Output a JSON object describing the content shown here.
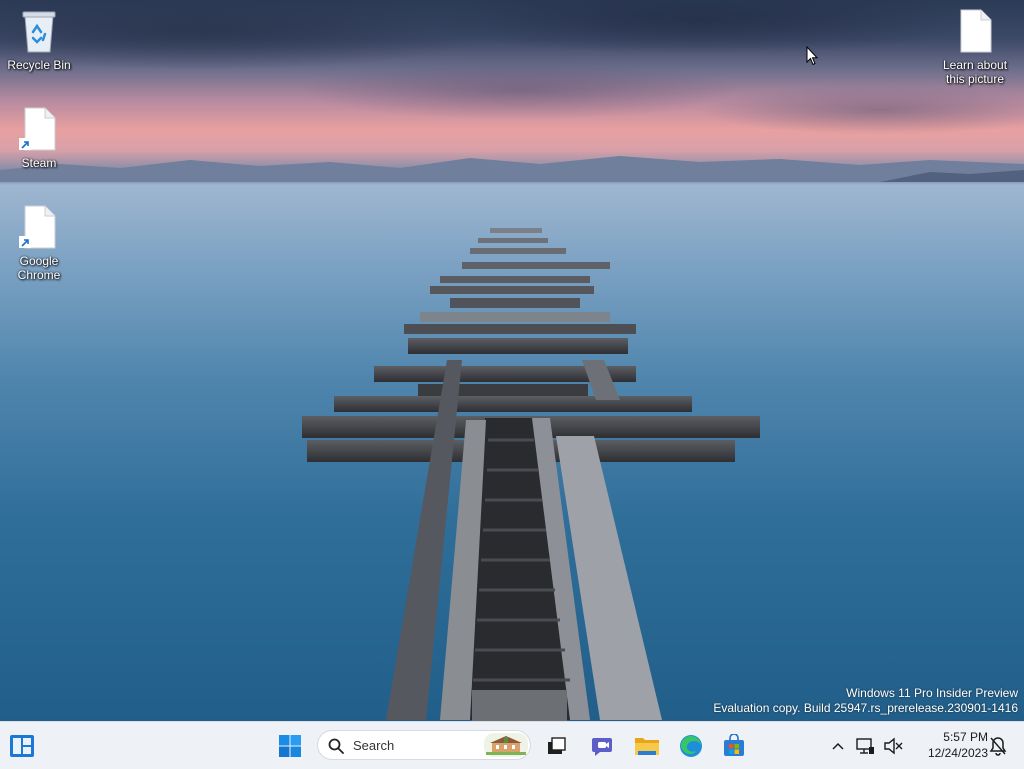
{
  "desktop": {
    "icons": [
      {
        "label": "Recycle Bin",
        "icon": "recycle-bin-icon"
      },
      {
        "label": "Steam",
        "icon": "file-shortcut-icon"
      },
      {
        "label": "Google Chrome",
        "icon": "file-shortcut-icon"
      },
      {
        "label": "Learn about this picture",
        "icon": "file-icon"
      }
    ],
    "watermark": {
      "line1": "Windows 11 Pro Insider Preview",
      "line2": "Evaluation copy. Build 25947.rs_prerelease.230901-1416"
    }
  },
  "taskbar": {
    "widgets_icon": "widgets-icon",
    "start_icon": "windows-start-icon",
    "search": {
      "placeholder": "Search",
      "icon": "search-icon"
    },
    "pinned": [
      {
        "name": "task-view",
        "icon": "task-view-icon"
      },
      {
        "name": "teams-chat",
        "icon": "chat-icon"
      },
      {
        "name": "file-explorer",
        "icon": "folder-icon"
      },
      {
        "name": "edge",
        "icon": "edge-browser-icon"
      },
      {
        "name": "microsoft-store",
        "icon": "store-icon"
      }
    ],
    "tray": {
      "overflow_icon": "chevron-up-icon",
      "network_icon": "network-icon",
      "volume_icon": "volume-muted-icon",
      "time": "5:57 PM",
      "date": "12/24/2023",
      "notification_icon": "notification-icon"
    }
  }
}
